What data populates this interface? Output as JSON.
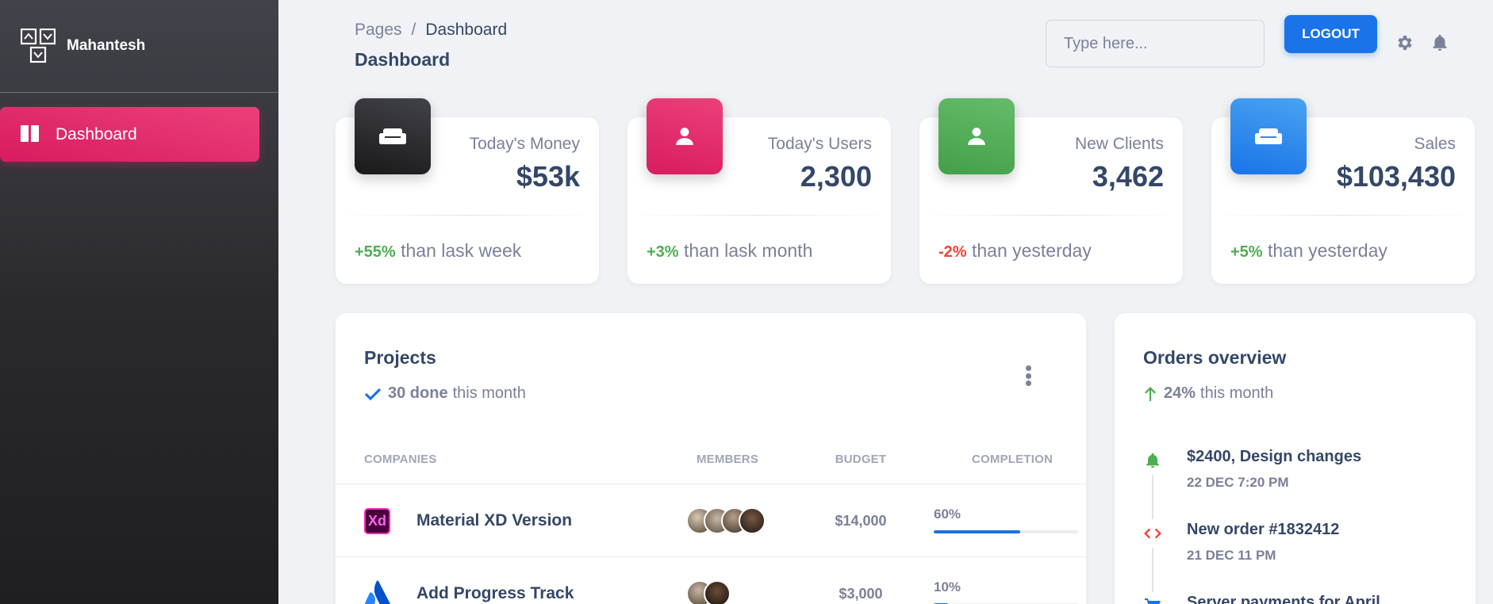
{
  "brand": {
    "name": "Mahantesh",
    "logo_icon": "grid-arrow-logo-icon"
  },
  "sidebar": {
    "items": [
      {
        "label": "Dashboard",
        "icon": "dashboard-icon",
        "active": true,
        "color": "#e91e63"
      }
    ]
  },
  "header": {
    "breadcrumb": [
      "Pages",
      "Dashboard"
    ],
    "breadcrumb_separator": "/",
    "title": "Dashboard",
    "search_placeholder": "Type here...",
    "logout_label": "LOGOUT",
    "icons": [
      "settings-icon",
      "notifications-icon"
    ]
  },
  "stats": [
    {
      "label": "Today's Money",
      "value": "$53k",
      "change": "+55%",
      "note": "than lask week",
      "trend": "up",
      "icon": "weekend-icon",
      "color": "#262629"
    },
    {
      "label": "Today's Users",
      "value": "2,300",
      "change": "+3%",
      "note": "than lask month",
      "trend": "up",
      "icon": "person-icon",
      "color": "#e91e63"
    },
    {
      "label": "New Clients",
      "value": "3,462",
      "change": "-2%",
      "note": "than yesterday",
      "trend": "down",
      "icon": "person-icon",
      "color": "#4caf50"
    },
    {
      "label": "Sales",
      "value": "$103,430",
      "change": "+5%",
      "note": "than yesterday",
      "trend": "up",
      "icon": "weekend-icon",
      "color": "#1a73e8"
    }
  ],
  "projects": {
    "title": "Projects",
    "done_count": "30 done",
    "done_suffix": "this month",
    "columns": [
      "COMPANIES",
      "MEMBERS",
      "BUDGET",
      "COMPLETION"
    ],
    "rows": [
      {
        "company": "Material XD Version",
        "logo": "xd-logo-icon",
        "logo_text": "Xd",
        "member_count": 4,
        "budget": "$14,000",
        "completion": "60%",
        "completion_value": 0.6
      },
      {
        "company": "Add Progress Track",
        "logo": "atlassian-logo-icon",
        "member_count": 2,
        "budget": "$3,000",
        "completion": "10%",
        "completion_value": 0.1
      }
    ]
  },
  "orders": {
    "title": "Orders overview",
    "change": "24%",
    "change_suffix": "this month",
    "items": [
      {
        "title": "$2400, Design changes",
        "date": "22 DEC 7:20 PM",
        "icon": "bell-icon",
        "color": "#4caf50"
      },
      {
        "title": "New order #1832412",
        "date": "21 DEC 11 PM",
        "icon": "code-icon",
        "color": "#f44335"
      },
      {
        "title": "Server payments for April",
        "icon": "cart-icon",
        "color": "#1a73e8"
      }
    ]
  }
}
